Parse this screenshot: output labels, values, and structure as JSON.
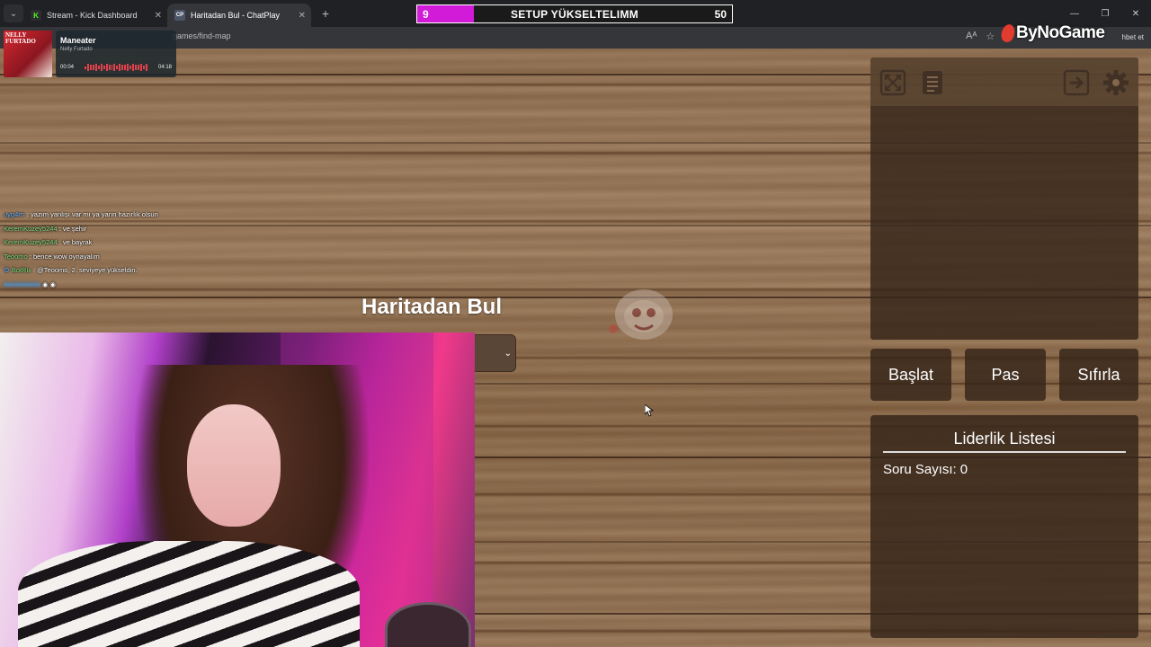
{
  "browser": {
    "tabs": [
      {
        "label": "Stream - Kick Dashboard",
        "favicon": "kick-icon",
        "active": false
      },
      {
        "label": "Haritadan Bul - ChatPlay",
        "favicon": "chatplay-icon",
        "active": true
      }
    ],
    "url_visible": "games/find-map",
    "right_text": "hbet et"
  },
  "goal": {
    "current": "9",
    "title": "SETUP YÜKSELTELIMM",
    "target": "50",
    "progress_fraction": 0.18,
    "accent": "#d21ad9"
  },
  "brand": {
    "name": "ByNoGame"
  },
  "music": {
    "album_text": "NELLY FURTADO",
    "title": "Maneater",
    "artist": "Nelly Furtado",
    "elapsed": "00:04",
    "duration": "04:18"
  },
  "chat": [
    {
      "user": "uyg4rrr",
      "message": ": yazım yanlışı var mı ya yarın hazırlık olsun",
      "user_color": "#6ab7ff"
    },
    {
      "user": "KeremKuzey5244",
      "message": ": ve şehir",
      "user_color": "#7fe07f"
    },
    {
      "user": "KeremKuzey5244",
      "message": ": ve bayrak",
      "user_color": "#7fe07f"
    },
    {
      "user": "Teoomo",
      "message": ": bence wow oynayalım",
      "user_color": "#7fe07f"
    },
    {
      "user": "BotRix",
      "message": ": @Teoomo, 2. seviyeye yükseldin.",
      "user_color": "#7fe07f"
    }
  ],
  "game": {
    "title": "Haritadan Bul",
    "select_chevron": "⌄"
  },
  "panel": {
    "tools": [
      "fullscreen-icon",
      "document-icon",
      "exit-icon",
      "settings-icon"
    ],
    "buttons": {
      "start": "Başlat",
      "pass": "Pas",
      "reset": "Sıfırla"
    },
    "leaderboard": {
      "title": "Liderlik Listesi",
      "question_count_label": "Soru Sayısı:",
      "question_count": "0"
    }
  }
}
